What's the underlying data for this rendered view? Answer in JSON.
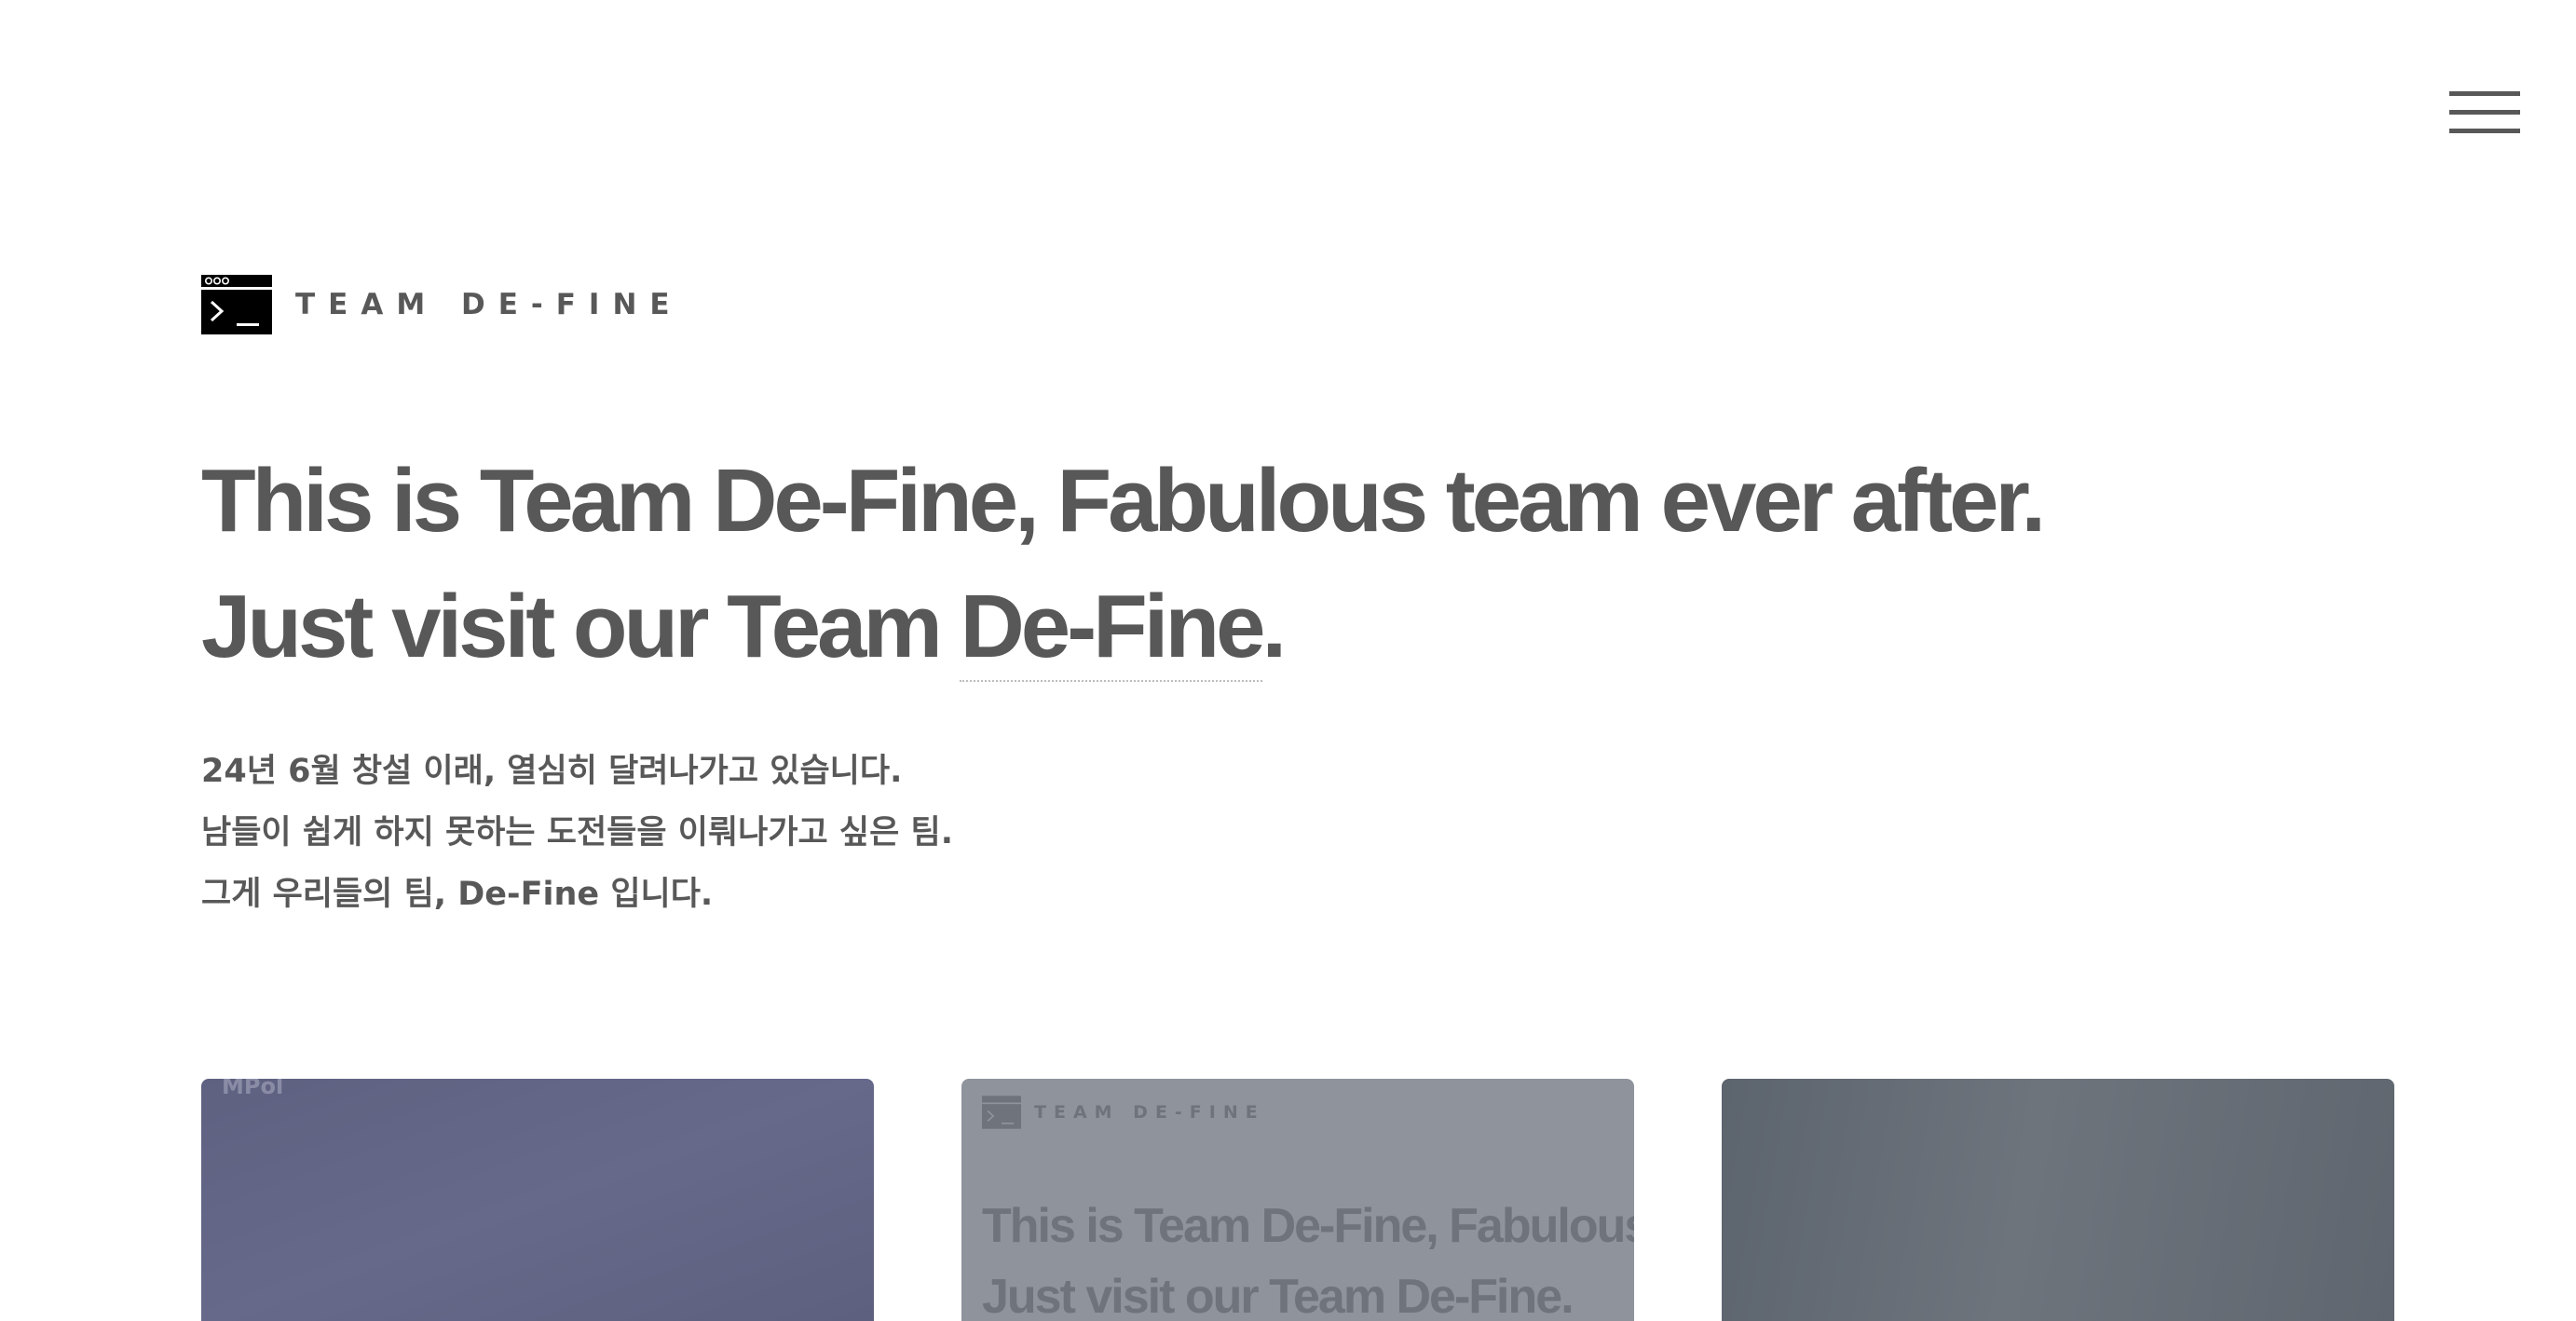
{
  "header": {
    "menu_icon": "hamburger-menu-icon"
  },
  "logo": {
    "icon": "terminal-prompt-icon",
    "text": "TEAM DE-FINE"
  },
  "headline": {
    "line1": "This is Team De-Fine, Fabulous team ever after.",
    "line2_prefix": "Just visit our Team ",
    "line2_link": "De-Fine",
    "line2_suffix": "."
  },
  "intro": {
    "lines": [
      "24년 6월 창설 이래, 열심히 달려나가고 있습니다.",
      "남들이 쉽게 하지 못하는 도전들을 이뤄나가고 싶은 팀.",
      "그게 우리들의 팀, De-Fine 입니다."
    ]
  },
  "cards": [
    {
      "label": "MPol",
      "color": "#63657f"
    },
    {
      "logo_text": "TEAM DE-FINE",
      "headline_line1": "This is Team De-Fine, Fabulous team ever after.",
      "headline_line2": "Just visit our Team De-Fine.",
      "color": "#8f939c"
    },
    {
      "color": "#636a73"
    }
  ],
  "colors": {
    "text": "#585858",
    "background": "#ffffff",
    "logo_mark": "#000000"
  }
}
